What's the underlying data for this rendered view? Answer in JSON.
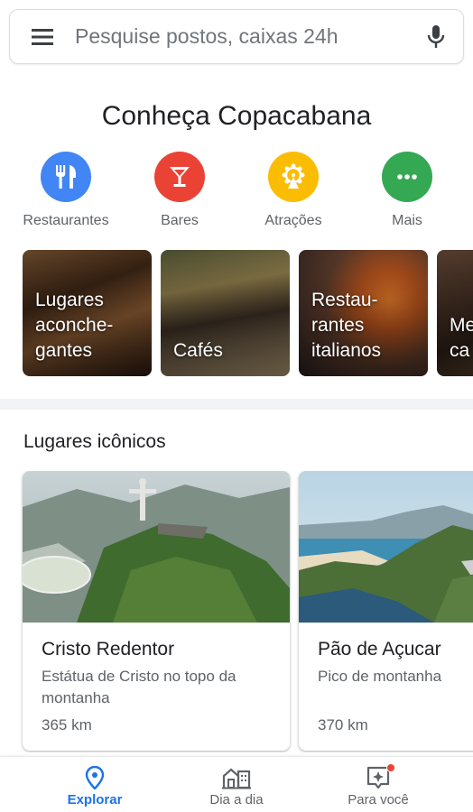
{
  "search": {
    "placeholder": "Pesquise postos, caixas 24h",
    "menu_icon": "hamburger-menu-icon",
    "mic_icon": "microphone-icon"
  },
  "heading": "Conheça Copacabana",
  "categories": [
    {
      "label": "Restaurantes",
      "icon": "fork-knife-icon",
      "color": "#4285f4"
    },
    {
      "label": "Bares",
      "icon": "cocktail-glass-icon",
      "color": "#ea4335"
    },
    {
      "label": "Atrações",
      "icon": "ferris-wheel-icon",
      "color": "#fbbc04"
    },
    {
      "label": "Mais",
      "icon": "more-dots-icon",
      "color": "#34a853"
    }
  ],
  "photo_cards": [
    {
      "label": "Lugares\naconche-\ngantes"
    },
    {
      "label": "Cafés"
    },
    {
      "label": "Restau-\nrantes\nitalianos"
    },
    {
      "label": "Me\nca"
    }
  ],
  "section_title": "Lugares icônicos",
  "places": [
    {
      "title": "Cristo Redentor",
      "description": "Estátua de Cristo no topo da montanha",
      "distance": "365 km"
    },
    {
      "title": "Pão de Açucar",
      "description": "Pico de montanha",
      "distance": "370 km"
    }
  ],
  "bottom_nav": [
    {
      "label": "Explorar",
      "icon": "location-pin-icon",
      "active": true
    },
    {
      "label": "Dia a dia",
      "icon": "commute-buildings-icon",
      "active": false
    },
    {
      "label": "Para você",
      "icon": "sparkle-badge-icon",
      "active": false
    }
  ],
  "colors": {
    "accent": "#1a73e8"
  }
}
